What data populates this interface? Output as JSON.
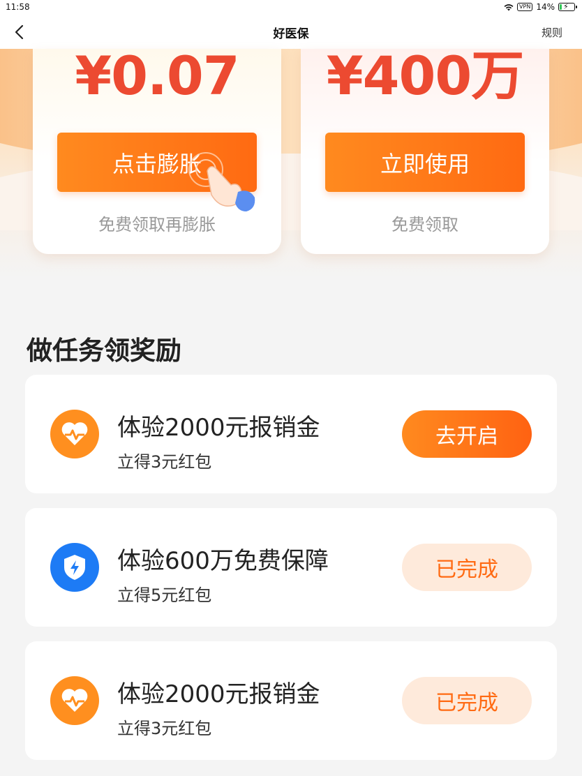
{
  "status_bar": {
    "time": "11:58",
    "vpn": "VPN",
    "battery_text": "14%",
    "battery_level": 0.14
  },
  "nav": {
    "title": "好医保",
    "rules_label": "规则"
  },
  "coupons": [
    {
      "amount": "¥0.07",
      "button_label": "点击膨胀",
      "subtext": "免费领取再膨胀"
    },
    {
      "amount": "¥400万",
      "button_label": "立即使用",
      "subtext": "免费领取"
    }
  ],
  "tasks_section": {
    "title": "做任务领奖励",
    "items": [
      {
        "title": "体验2000元报销金",
        "subtitle": "立得3元红包",
        "button_label": "去开启",
        "icon": "heart-pulse-icon",
        "icon_color": "#ff8f1f"
      },
      {
        "title": "体验600万免费保障",
        "subtitle": "立得5元红包",
        "button_label": "已完成",
        "icon": "shield-bolt-icon",
        "icon_color": "#1d7bf5"
      },
      {
        "title": "体验2000元报销金",
        "subtitle": "立得3元红包",
        "button_label": "已完成",
        "icon": "heart-pulse-icon",
        "icon_color": "#ff8f1f"
      }
    ]
  },
  "colors": {
    "accent_orange": "#ff6a12",
    "price_red": "#ec4a31",
    "done_bg": "#feeadb"
  }
}
